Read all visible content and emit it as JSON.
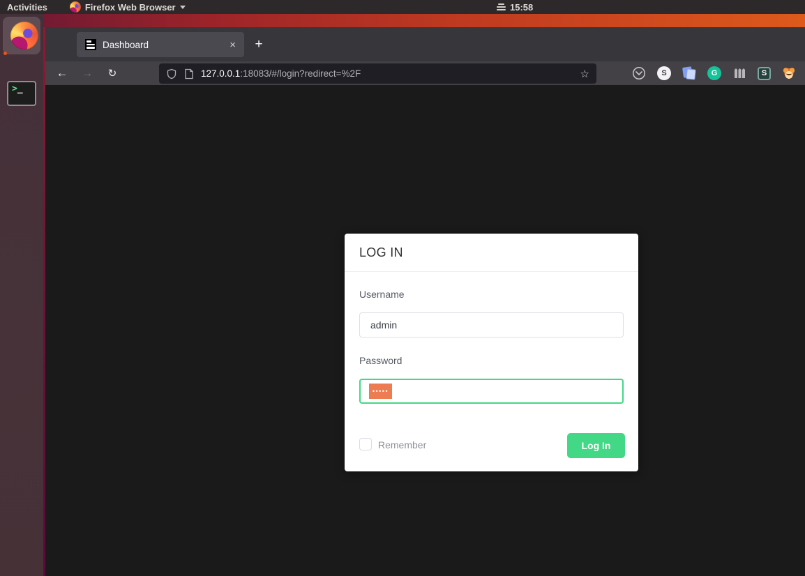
{
  "colors": {
    "accent_green": "#42d885",
    "selection_orange": "#ee7c52",
    "page_background": "#1a1a1a",
    "card_background": "#ffffff",
    "panel_background": "#2d2829"
  },
  "top_bar": {
    "activities": "Activities",
    "app_menu_label": "Firefox Web Browser",
    "clock_time": "15:58",
    "weekday_icon": "三"
  },
  "dock": {
    "items": [
      {
        "name": "firefox",
        "running": true
      },
      {
        "name": "terminal",
        "running": false
      }
    ],
    "terminal_prompt_gt": ">",
    "terminal_prompt_underscore": "_"
  },
  "browser": {
    "tab": {
      "title": "Dashboard",
      "close_glyph": "×"
    },
    "new_tab_glyph": "+",
    "nav": {
      "back_glyph": "←",
      "forward_glyph": "→",
      "reload_glyph": "↻"
    },
    "urlbar": {
      "host": "127.0.0.1",
      "path": ":18083/#/login?redirect=%2F",
      "star_glyph": "☆"
    },
    "extensions": [
      {
        "name": "pocket"
      },
      {
        "name": "s-white-circle",
        "letter": "S"
      },
      {
        "name": "blue-notes"
      },
      {
        "name": "grammarly",
        "letter": "G"
      },
      {
        "name": "fence"
      },
      {
        "name": "s-dark-square",
        "letter": "S"
      },
      {
        "name": "monkey"
      }
    ]
  },
  "login": {
    "title": "LOG IN",
    "username_label": "Username",
    "username_value": "admin",
    "password_label": "Password",
    "password_dots": "•••••",
    "remember_label": "Remember",
    "submit_label": "Log In"
  }
}
